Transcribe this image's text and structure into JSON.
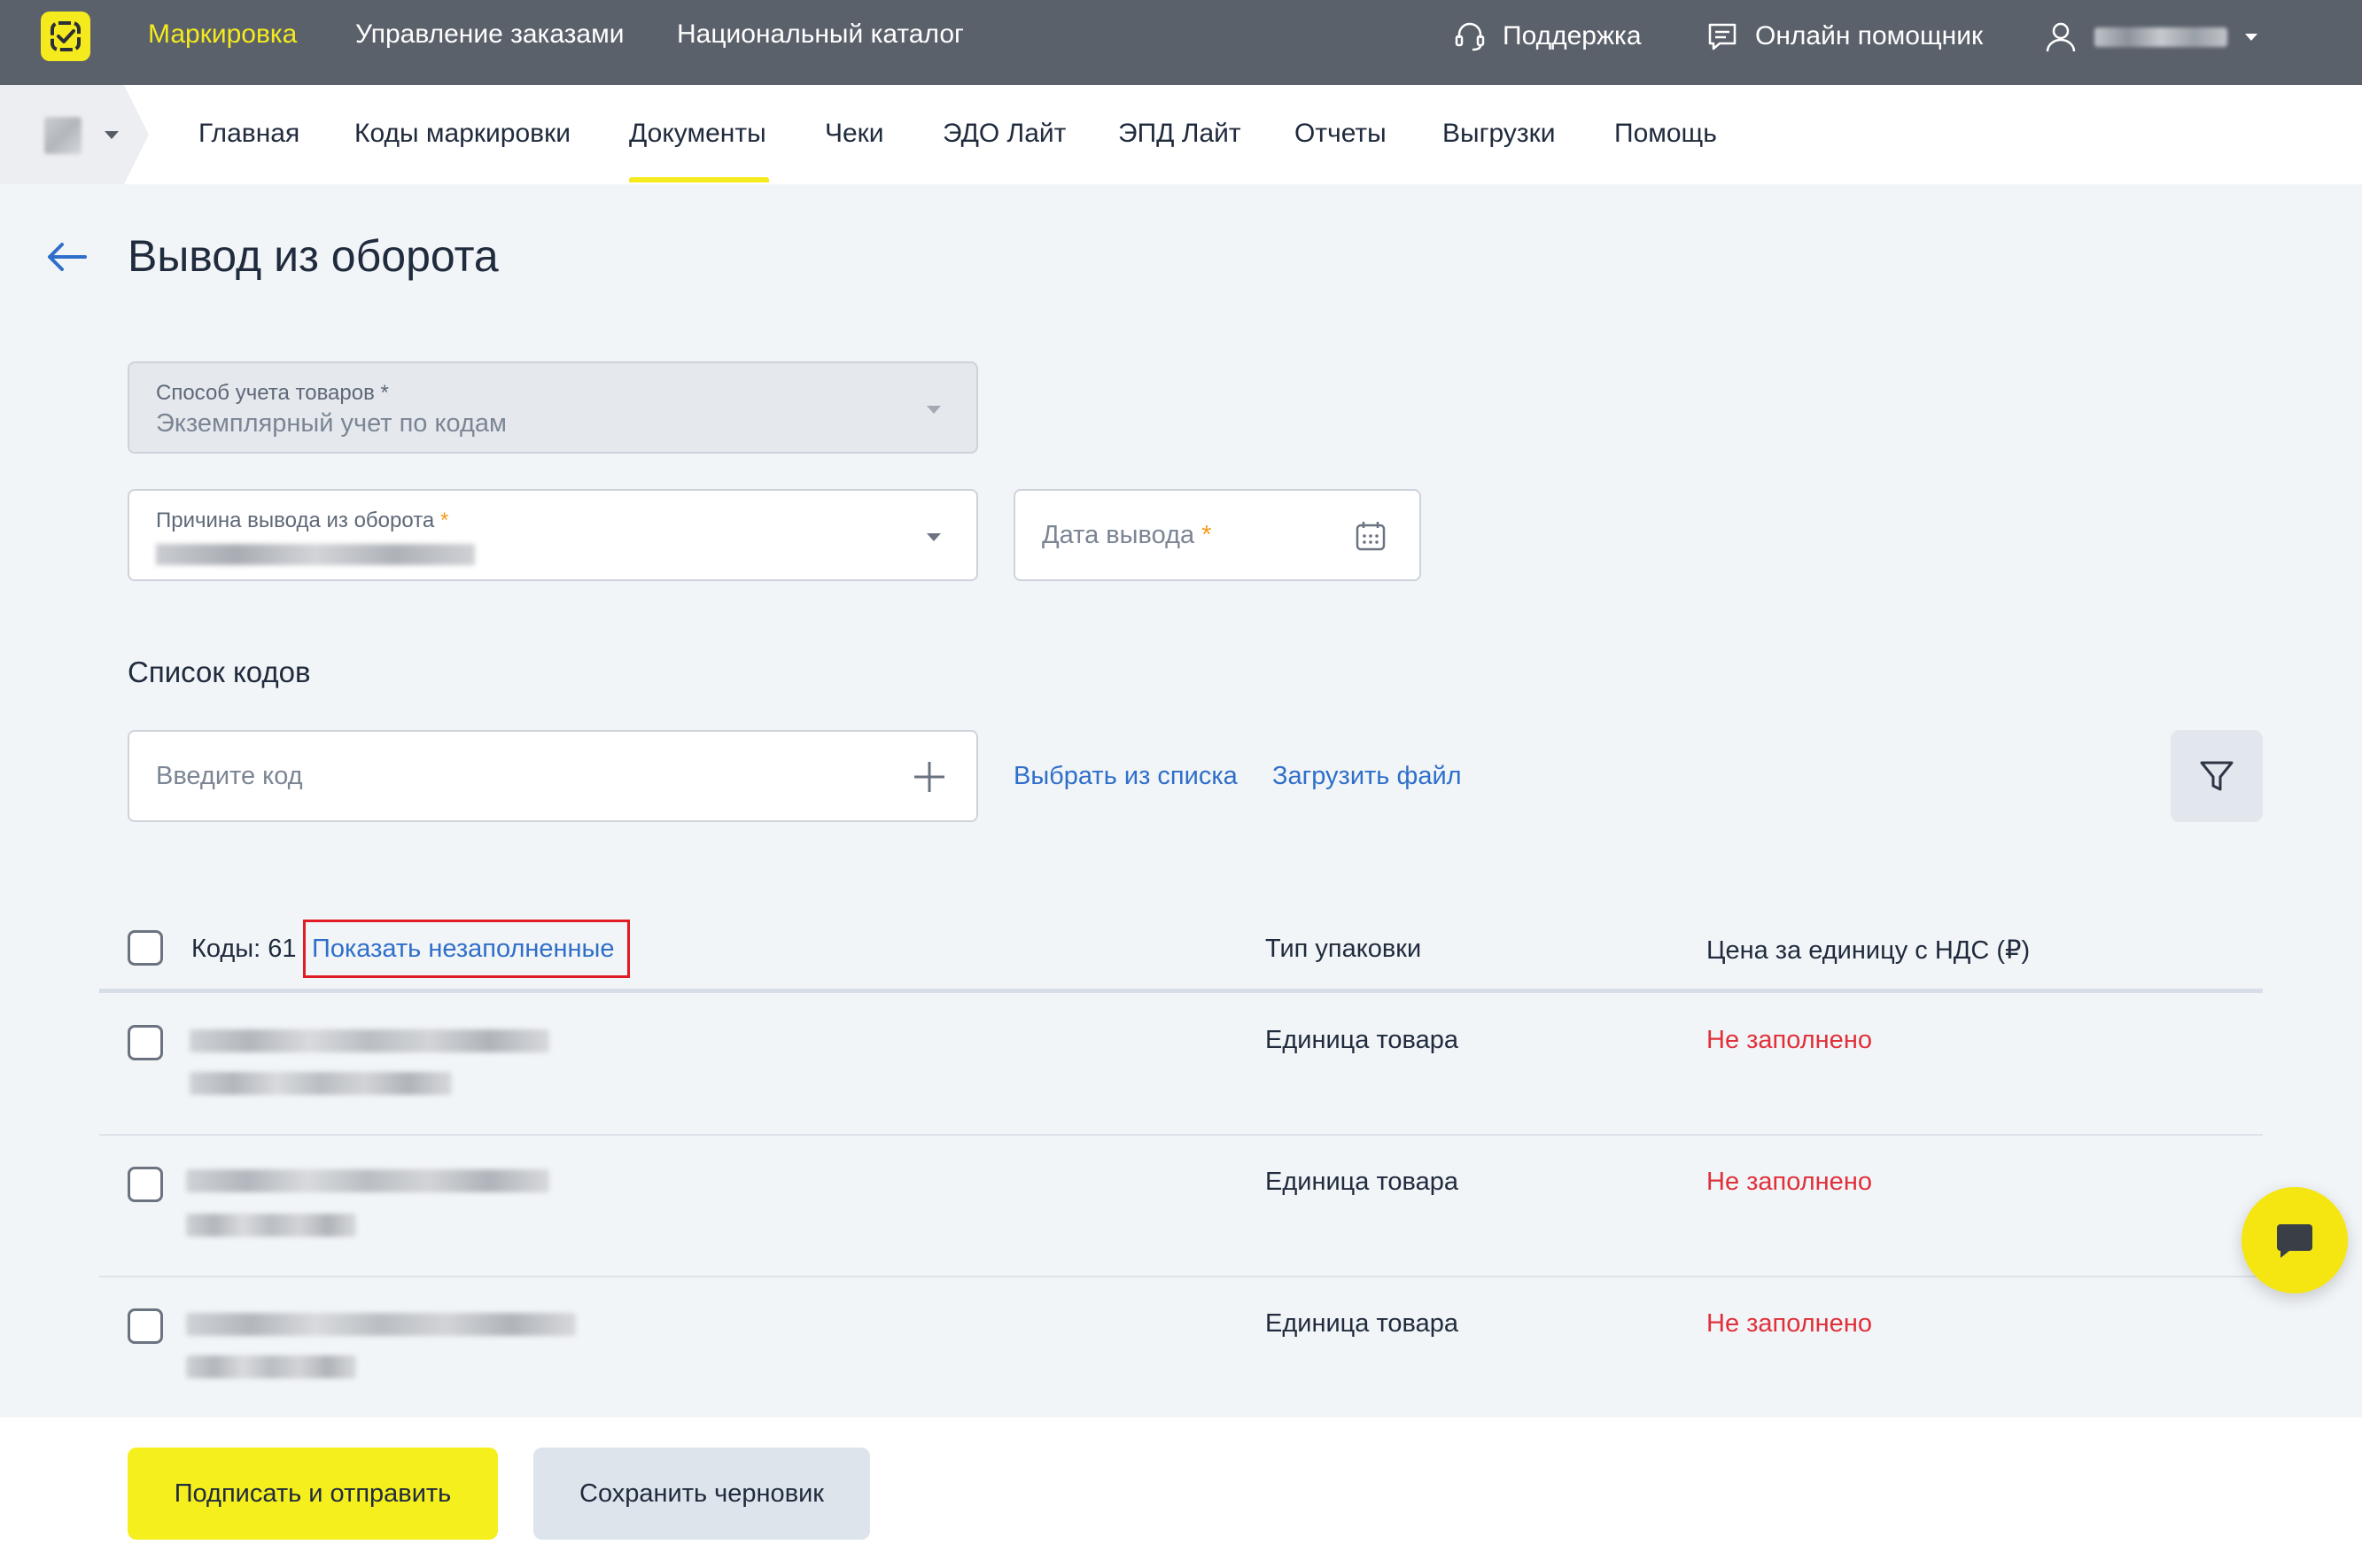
{
  "topbar": {
    "nav": [
      "Маркировка",
      "Управление заказами",
      "Национальный каталог"
    ],
    "support_label": "Поддержка",
    "assistant_label": "Онлайн помощник",
    "accent_color": "#f5ea1e"
  },
  "subnav": {
    "items": [
      "Главная",
      "Коды маркировки",
      "Документы",
      "Чеки",
      "ЭДО Лайт",
      "ЭПД Лайт",
      "Отчеты",
      "Выгрузки",
      "Помощь"
    ],
    "active": "Документы"
  },
  "page": {
    "title": "Вывод из оборота"
  },
  "form": {
    "accounting_method": {
      "label": "Способ учета товаров",
      "required_mark": "*",
      "value": "Экземплярный учет по кодам"
    },
    "withdrawal_reason": {
      "label": "Причина вывода из оборота",
      "required_mark": "*"
    },
    "withdrawal_date": {
      "placeholder": "Дата вывода",
      "required_mark": "*"
    }
  },
  "codes": {
    "section_title": "Список кодов",
    "input_placeholder": "Введите код",
    "choose_from_list": "Выбрать из списка",
    "upload_file": "Загрузить файл",
    "count_label": "Коды: 61",
    "show_unfilled": "Показать незаполненные",
    "columns": [
      "Тип упаковки",
      "Цена за единицу с НДС (₽)"
    ],
    "rows": [
      {
        "package_type": "Единица товара",
        "price": "Не заполнено"
      },
      {
        "package_type": "Единица товара",
        "price": "Не заполнено"
      },
      {
        "package_type": "Единица товара",
        "price": "Не заполнено"
      }
    ],
    "error_color": "#e0303a"
  },
  "footer": {
    "sign_send_label": "Подписать и отправить",
    "save_draft_label": "Сохранить черновик"
  }
}
